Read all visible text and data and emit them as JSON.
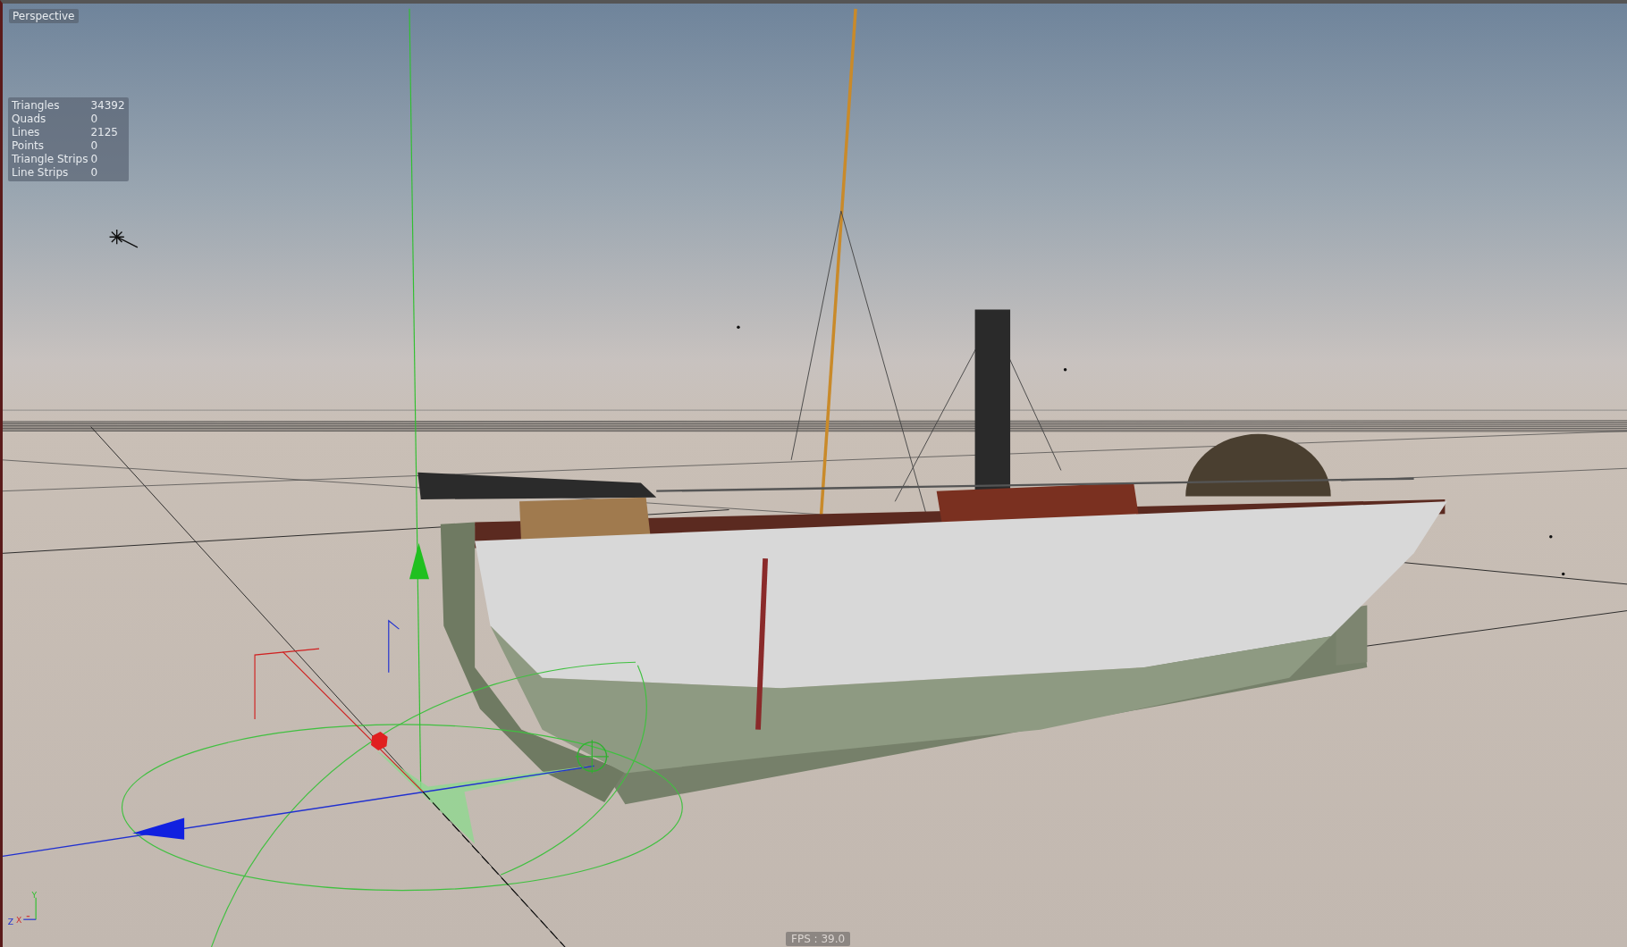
{
  "viewport": {
    "label": "Perspective"
  },
  "stats": [
    {
      "name": "Triangles",
      "value": "34392"
    },
    {
      "name": "Quads",
      "value": "0"
    },
    {
      "name": "Lines",
      "value": "2125"
    },
    {
      "name": "Points",
      "value": "0"
    },
    {
      "name": "Triangle Strips",
      "value": "0"
    },
    {
      "name": "Line Strips",
      "value": "0"
    }
  ],
  "axis_indicator": {
    "x": "X",
    "y": "Y",
    "z": "Z"
  },
  "fps": "FPS : 39.0"
}
